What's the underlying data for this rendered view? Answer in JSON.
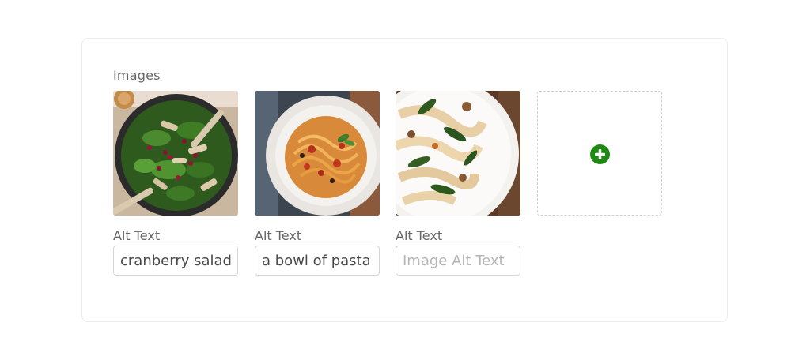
{
  "section": {
    "label": "Images"
  },
  "images": [
    {
      "name": "salad-thumbnail",
      "alt_label": "Alt Text",
      "alt_value": "cranberry salad",
      "alt_placeholder": "Image Alt Text"
    },
    {
      "name": "pasta-bowl-thumbnail",
      "alt_label": "Alt Text",
      "alt_value": "a bowl of pasta",
      "alt_placeholder": "Image Alt Text"
    },
    {
      "name": "pappardelle-thumbnail",
      "alt_label": "Alt Text",
      "alt_value": "",
      "alt_placeholder": "Image Alt Text"
    }
  ],
  "add_button": {
    "icon": "plus-circle-icon",
    "color": "#1f8a13"
  },
  "colors": {
    "label": "#666666",
    "input_text": "#4a4a4a",
    "placeholder": "#b5b5b5",
    "accent_green": "#1f8a13"
  }
}
